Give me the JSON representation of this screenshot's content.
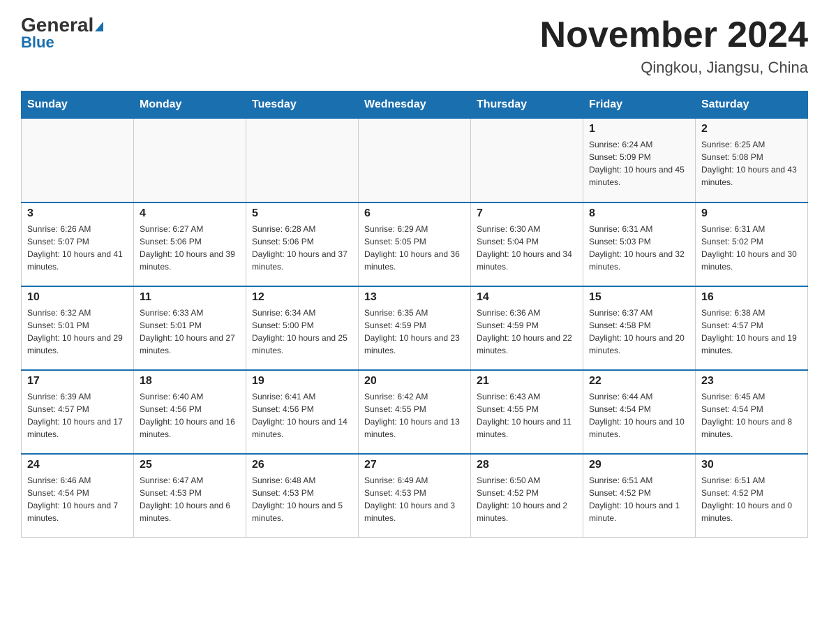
{
  "header": {
    "logo_general": "General",
    "logo_blue": "Blue",
    "title": "November 2024",
    "subtitle": "Qingkou, Jiangsu, China"
  },
  "weekdays": [
    "Sunday",
    "Monday",
    "Tuesday",
    "Wednesday",
    "Thursday",
    "Friday",
    "Saturday"
  ],
  "weeks": [
    [
      {
        "day": "",
        "info": ""
      },
      {
        "day": "",
        "info": ""
      },
      {
        "day": "",
        "info": ""
      },
      {
        "day": "",
        "info": ""
      },
      {
        "day": "",
        "info": ""
      },
      {
        "day": "1",
        "info": "Sunrise: 6:24 AM\nSunset: 5:09 PM\nDaylight: 10 hours and 45 minutes."
      },
      {
        "day": "2",
        "info": "Sunrise: 6:25 AM\nSunset: 5:08 PM\nDaylight: 10 hours and 43 minutes."
      }
    ],
    [
      {
        "day": "3",
        "info": "Sunrise: 6:26 AM\nSunset: 5:07 PM\nDaylight: 10 hours and 41 minutes."
      },
      {
        "day": "4",
        "info": "Sunrise: 6:27 AM\nSunset: 5:06 PM\nDaylight: 10 hours and 39 minutes."
      },
      {
        "day": "5",
        "info": "Sunrise: 6:28 AM\nSunset: 5:06 PM\nDaylight: 10 hours and 37 minutes."
      },
      {
        "day": "6",
        "info": "Sunrise: 6:29 AM\nSunset: 5:05 PM\nDaylight: 10 hours and 36 minutes."
      },
      {
        "day": "7",
        "info": "Sunrise: 6:30 AM\nSunset: 5:04 PM\nDaylight: 10 hours and 34 minutes."
      },
      {
        "day": "8",
        "info": "Sunrise: 6:31 AM\nSunset: 5:03 PM\nDaylight: 10 hours and 32 minutes."
      },
      {
        "day": "9",
        "info": "Sunrise: 6:31 AM\nSunset: 5:02 PM\nDaylight: 10 hours and 30 minutes."
      }
    ],
    [
      {
        "day": "10",
        "info": "Sunrise: 6:32 AM\nSunset: 5:01 PM\nDaylight: 10 hours and 29 minutes."
      },
      {
        "day": "11",
        "info": "Sunrise: 6:33 AM\nSunset: 5:01 PM\nDaylight: 10 hours and 27 minutes."
      },
      {
        "day": "12",
        "info": "Sunrise: 6:34 AM\nSunset: 5:00 PM\nDaylight: 10 hours and 25 minutes."
      },
      {
        "day": "13",
        "info": "Sunrise: 6:35 AM\nSunset: 4:59 PM\nDaylight: 10 hours and 23 minutes."
      },
      {
        "day": "14",
        "info": "Sunrise: 6:36 AM\nSunset: 4:59 PM\nDaylight: 10 hours and 22 minutes."
      },
      {
        "day": "15",
        "info": "Sunrise: 6:37 AM\nSunset: 4:58 PM\nDaylight: 10 hours and 20 minutes."
      },
      {
        "day": "16",
        "info": "Sunrise: 6:38 AM\nSunset: 4:57 PM\nDaylight: 10 hours and 19 minutes."
      }
    ],
    [
      {
        "day": "17",
        "info": "Sunrise: 6:39 AM\nSunset: 4:57 PM\nDaylight: 10 hours and 17 minutes."
      },
      {
        "day": "18",
        "info": "Sunrise: 6:40 AM\nSunset: 4:56 PM\nDaylight: 10 hours and 16 minutes."
      },
      {
        "day": "19",
        "info": "Sunrise: 6:41 AM\nSunset: 4:56 PM\nDaylight: 10 hours and 14 minutes."
      },
      {
        "day": "20",
        "info": "Sunrise: 6:42 AM\nSunset: 4:55 PM\nDaylight: 10 hours and 13 minutes."
      },
      {
        "day": "21",
        "info": "Sunrise: 6:43 AM\nSunset: 4:55 PM\nDaylight: 10 hours and 11 minutes."
      },
      {
        "day": "22",
        "info": "Sunrise: 6:44 AM\nSunset: 4:54 PM\nDaylight: 10 hours and 10 minutes."
      },
      {
        "day": "23",
        "info": "Sunrise: 6:45 AM\nSunset: 4:54 PM\nDaylight: 10 hours and 8 minutes."
      }
    ],
    [
      {
        "day": "24",
        "info": "Sunrise: 6:46 AM\nSunset: 4:54 PM\nDaylight: 10 hours and 7 minutes."
      },
      {
        "day": "25",
        "info": "Sunrise: 6:47 AM\nSunset: 4:53 PM\nDaylight: 10 hours and 6 minutes."
      },
      {
        "day": "26",
        "info": "Sunrise: 6:48 AM\nSunset: 4:53 PM\nDaylight: 10 hours and 5 minutes."
      },
      {
        "day": "27",
        "info": "Sunrise: 6:49 AM\nSunset: 4:53 PM\nDaylight: 10 hours and 3 minutes."
      },
      {
        "day": "28",
        "info": "Sunrise: 6:50 AM\nSunset: 4:52 PM\nDaylight: 10 hours and 2 minutes."
      },
      {
        "day": "29",
        "info": "Sunrise: 6:51 AM\nSunset: 4:52 PM\nDaylight: 10 hours and 1 minute."
      },
      {
        "day": "30",
        "info": "Sunrise: 6:51 AM\nSunset: 4:52 PM\nDaylight: 10 hours and 0 minutes."
      }
    ]
  ]
}
